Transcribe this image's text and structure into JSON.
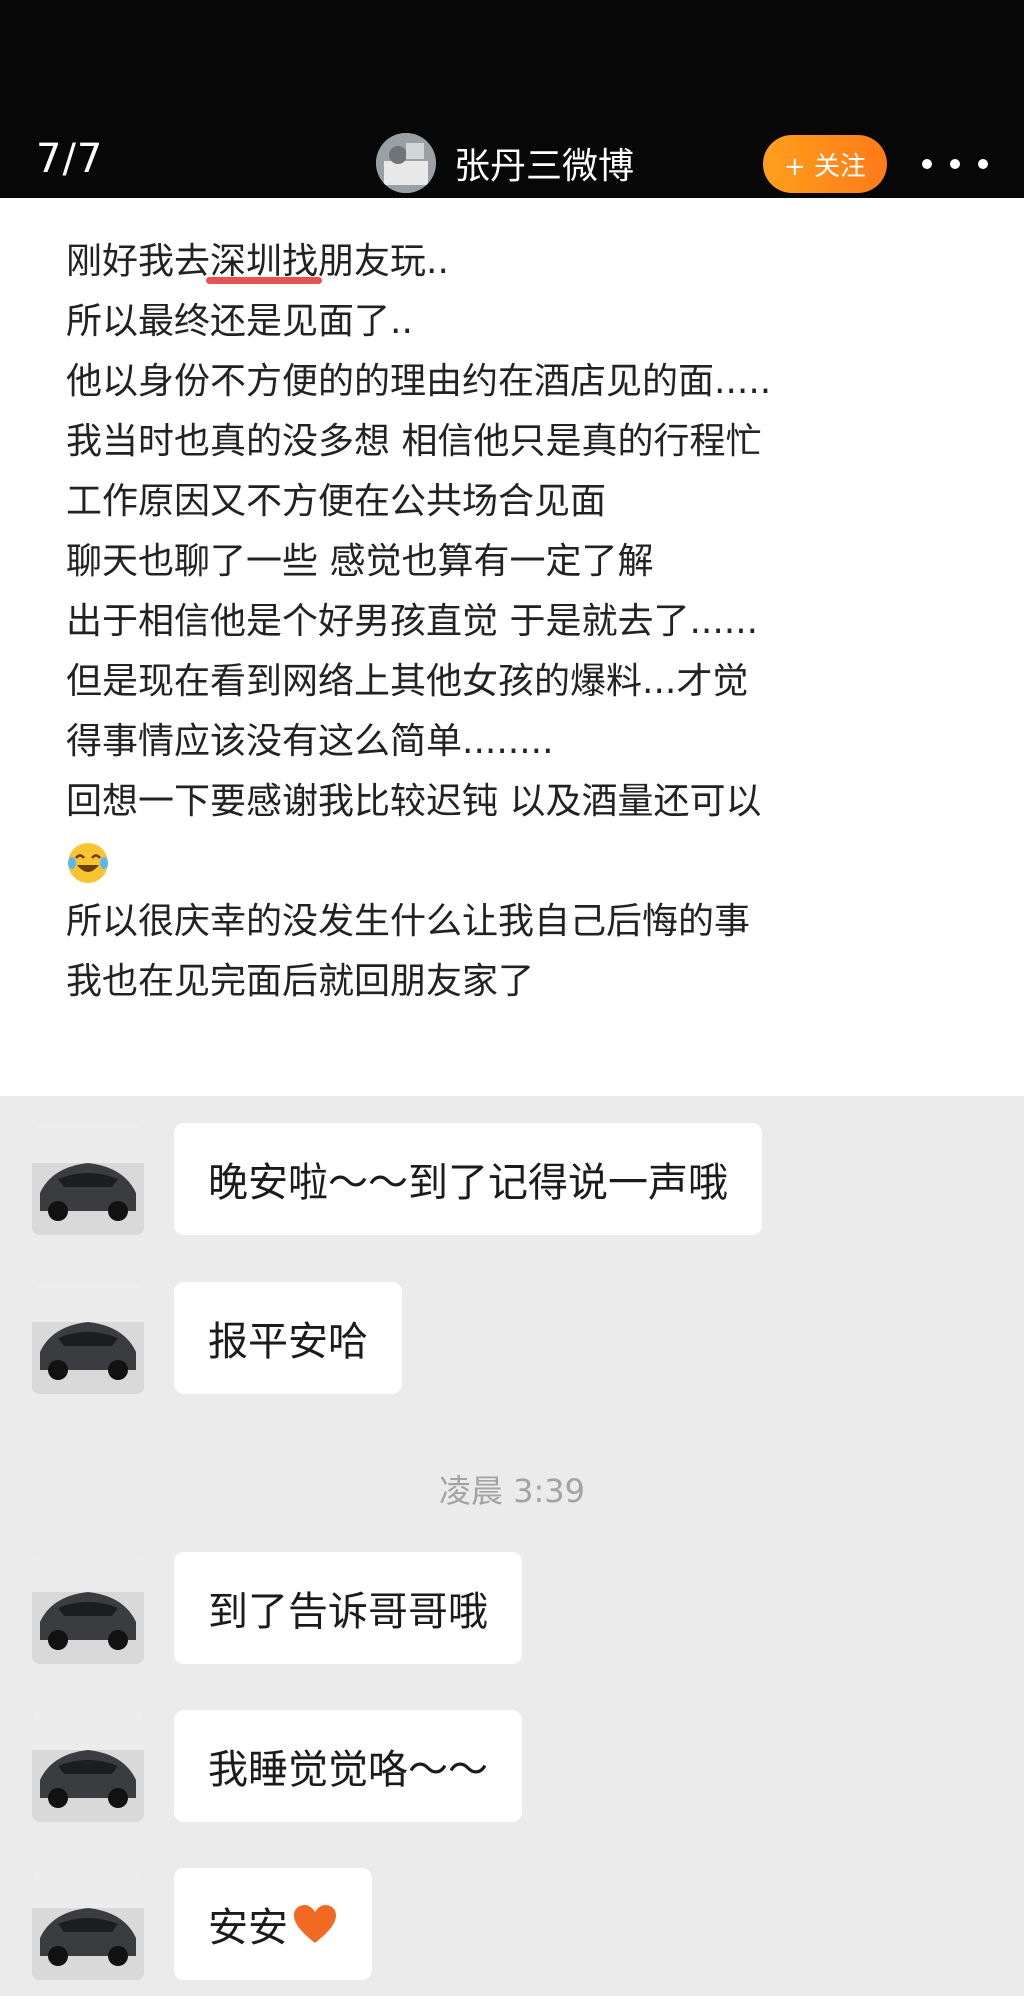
{
  "header": {
    "counter": "7/7",
    "account_name": "张丹三微博",
    "follow_label": "+ 关注",
    "avatar_icon": "profile-photo-icon",
    "more_icon": "more-dots-icon",
    "follow_color": "#ff8a1a"
  },
  "article": {
    "lines": [
      "刚好我去",
      "所以最终还是见面了..",
      "他以身份不方便的的理由约在酒店见的面.....",
      "我当时也真的没多想 相信他只是真的行程忙",
      "工作原因又不方便在公共场合见面",
      "聊天也聊了一些 感觉也算有一定了解",
      "出于相信他是个好男孩直觉 于是就去了......",
      "但是现在看到网络上其他女孩的爆料...才觉",
      "得事情应该没有这么简单........",
      "回想一下要感谢我比较迟钝 以及酒量还可以",
      "所以很庆幸的没发生什么让我自己后悔的事",
      "我也在见完面后就回朋友家了"
    ],
    "underlined_text": "深圳找",
    "line1_tail": "朋友玩..",
    "emoji_icon": "laughing-tears-emoji-icon",
    "underline_color": "#e03535"
  },
  "chat": {
    "messages": [
      {
        "text": "晚安啦～～到了记得说一声哦"
      },
      {
        "text": "报平安哈"
      },
      {
        "text": "到了告诉哥哥哦"
      },
      {
        "text": "我睡觉觉咯～～"
      },
      {
        "text": "安安"
      }
    ],
    "timestamp": "凌晨 3:39",
    "avatar_icon": "sports-car-avatar-icon",
    "heart_icon": "orange-heart-emoji-icon",
    "bubble_color": "#ffffff",
    "background_color": "#ebebeb"
  }
}
